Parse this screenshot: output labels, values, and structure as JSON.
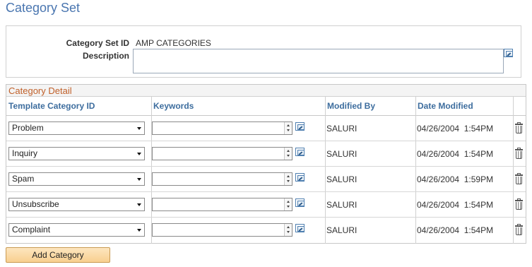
{
  "page": {
    "title": "Category Set"
  },
  "header": {
    "category_set_id_label": "Category Set ID",
    "category_set_id_value": "AMP CATEGORIES",
    "description_label": "Description",
    "description_value": ""
  },
  "grid": {
    "caption": "Category Detail",
    "columns": {
      "template_category_id": "Template Category ID",
      "keywords": "Keywords",
      "modified_by": "Modified By",
      "date_modified": "Date Modified"
    },
    "rows": [
      {
        "template": "Problem",
        "keywords": "",
        "modified_by": "SALURI",
        "date_modified": "04/26/2004  1:54PM"
      },
      {
        "template": "Inquiry",
        "keywords": "",
        "modified_by": "SALURI",
        "date_modified": "04/26/2004  1:54PM"
      },
      {
        "template": "Spam",
        "keywords": "",
        "modified_by": "SALURI",
        "date_modified": "04/26/2004  1:59PM"
      },
      {
        "template": "Unsubscribe",
        "keywords": "",
        "modified_by": "SALURI",
        "date_modified": "04/26/2004  1:54PM"
      },
      {
        "template": "Complaint",
        "keywords": "",
        "modified_by": "SALURI",
        "date_modified": "04/26/2004  1:54PM"
      }
    ]
  },
  "actions": {
    "add_category_label": "Add Category"
  },
  "icons": {
    "expand": "expand-edit-icon",
    "dropdown": "chevron-down-icon",
    "spinner": "spinner-icon",
    "delete": "trash-icon"
  },
  "colors": {
    "title": "#4a76b0",
    "caption": "#c0602a",
    "column_header": "#3d6d9e",
    "button_bg": "#f8cf8f"
  }
}
